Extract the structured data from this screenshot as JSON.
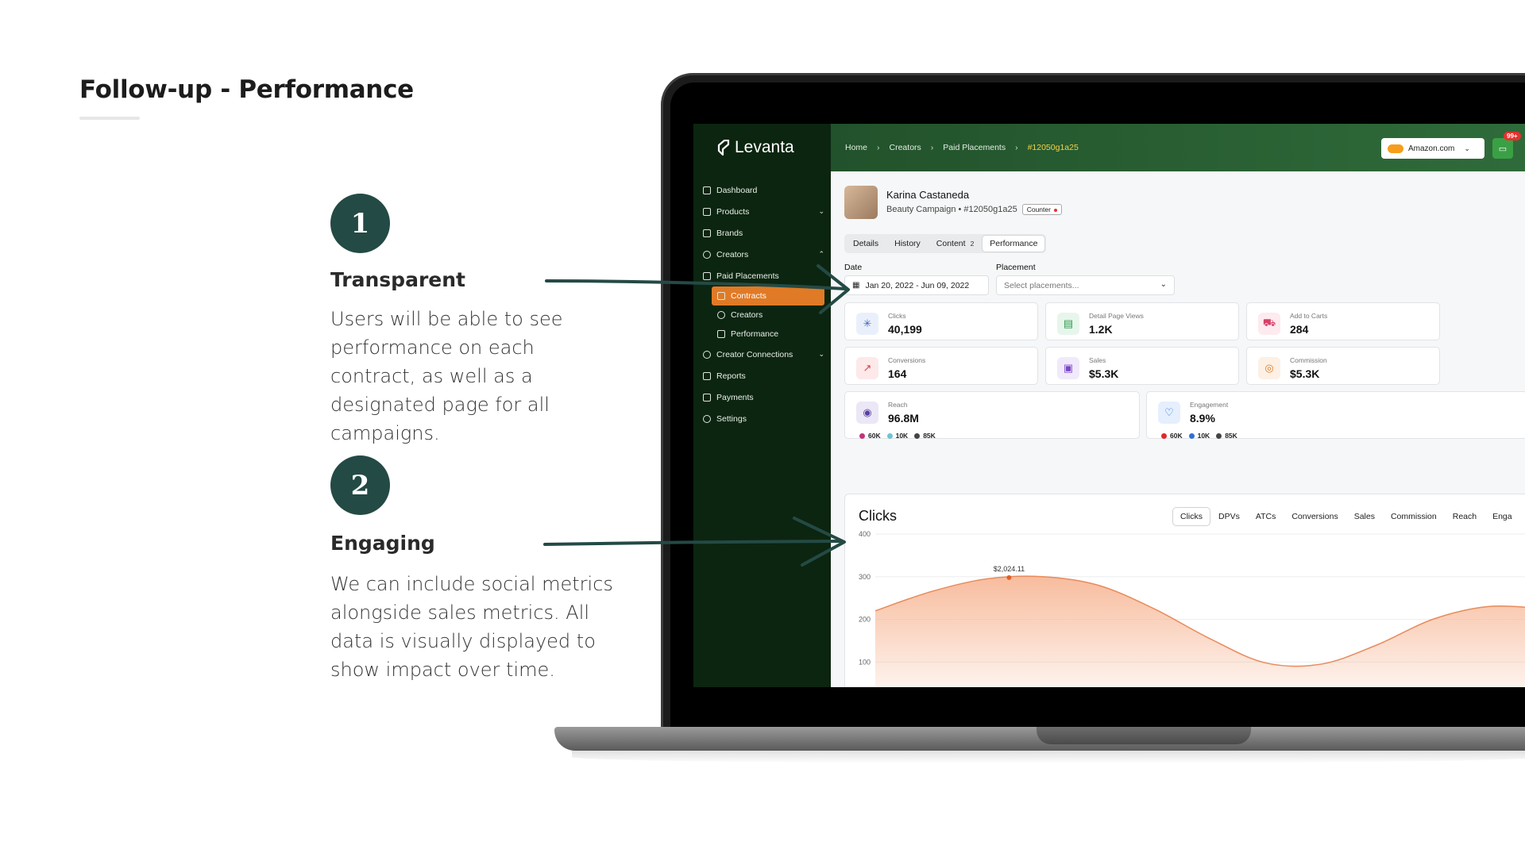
{
  "slide": {
    "title": "Follow-up - Performance",
    "points": [
      {
        "number": "1",
        "heading": "Transparent",
        "body": "Users will be able to see performance on each contract, as well as a designated page for all campaigns."
      },
      {
        "number": "2",
        "heading": "Engaging",
        "body": "We can include social metrics alongside sales metrics. All data is visually displayed to show impact over time."
      }
    ]
  },
  "app": {
    "logo": "Levanta",
    "sidebar": {
      "items": [
        {
          "label": "Dashboard",
          "icon": "home-icon"
        },
        {
          "label": "Products",
          "icon": "box-icon",
          "chevron": "⌄"
        },
        {
          "label": "Brands",
          "icon": "tag-icon"
        },
        {
          "label": "Creators",
          "icon": "user-icon",
          "chevron": "⌃"
        },
        {
          "label": "Paid Placements",
          "icon": "image-icon"
        },
        {
          "label": "Contracts",
          "icon": "file-icon"
        },
        {
          "label": "Creators",
          "icon": "user-icon"
        },
        {
          "label": "Performance",
          "icon": "chart-icon"
        },
        {
          "label": "Creator Connections",
          "icon": "user-link-icon",
          "chevron": "⌄"
        },
        {
          "label": "Reports",
          "icon": "bar-chart-icon"
        },
        {
          "label": "Payments",
          "icon": "card-icon"
        },
        {
          "label": "Settings",
          "icon": "gear-icon"
        }
      ]
    },
    "header": {
      "breadcrumbs": [
        "Home",
        "Creators",
        "Paid Placements",
        "#12050g1a25"
      ],
      "store": "Amazon.com",
      "badge": "99+"
    },
    "profile": {
      "name": "Karina Castaneda",
      "subtitle": "Beauty Campaign • #12050g1a25",
      "chip": "Counter"
    },
    "tabs": [
      {
        "label": "Details"
      },
      {
        "label": "History"
      },
      {
        "label": "Content",
        "count": "2"
      },
      {
        "label": "Performance",
        "active": true
      }
    ],
    "filters": {
      "date_label": "Date",
      "date_value": "Jan 20, 2022 - Jun 09, 2022",
      "placement_label": "Placement",
      "placement_placeholder": "Select placements..."
    },
    "metrics": [
      {
        "label": "Clicks",
        "value": "40,199"
      },
      {
        "label": "Detail Page Views",
        "value": "1.2K"
      },
      {
        "label": "Add to Carts",
        "value": "284"
      },
      {
        "label": "Conversions",
        "value": "164"
      },
      {
        "label": "Sales",
        "value": "$5.3K"
      },
      {
        "label": "Commission",
        "value": "$5.3K"
      }
    ],
    "social": [
      {
        "label": "Reach",
        "value": "96.8M",
        "legend": [
          "60K",
          "10K",
          "85K"
        ]
      },
      {
        "label": "Engagement",
        "value": "8.9%",
        "legend": [
          "60K",
          "10K",
          "85K"
        ]
      }
    ],
    "chart_tabs": [
      "Clicks",
      "DPVs",
      "ATCs",
      "Conversions",
      "Sales",
      "Commission",
      "Reach",
      "Enga"
    ]
  },
  "chart_data": {
    "type": "area",
    "title": "Clicks",
    "y_ticks": [
      "400",
      "300",
      "200",
      "100"
    ],
    "ylim": [
      0,
      400
    ],
    "x": [
      0,
      1,
      2,
      3,
      4,
      5,
      6,
      7,
      8,
      9,
      10,
      11,
      12
    ],
    "series": [
      {
        "values": [
          220,
          265,
          295,
          300,
          280,
          225,
          155,
          98,
          95,
          140,
          200,
          230,
          225
        ]
      }
    ],
    "annotation": {
      "label": "$2,024.11",
      "x": 2.4,
      "y": 298
    },
    "colors": {
      "line": "#e88a5a",
      "fill": "#f6b08c"
    }
  }
}
